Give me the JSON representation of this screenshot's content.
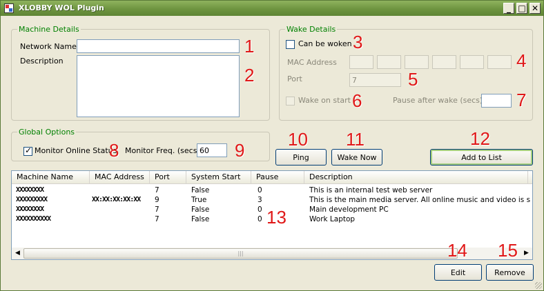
{
  "window": {
    "title": "XLOBBY WOL Plugin",
    "minimize": "_",
    "maximize": "□",
    "close": "✕"
  },
  "machine_details": {
    "legend": "Machine Details",
    "network_name_label": "Network Name:",
    "network_name_value": "",
    "description_label": "Description",
    "description_value": ""
  },
  "wake_details": {
    "legend": "Wake Details",
    "can_be_woken_label": "Can be woken",
    "can_be_woken_checked": false,
    "mac_label": "MAC Address",
    "mac_octets": [
      "",
      "",
      "",
      "",
      "",
      ""
    ],
    "port_label": "Port",
    "port_value": "7",
    "wake_on_start_label": "Wake on start",
    "wake_on_start_checked": false,
    "pause_label": "Pause after wake (secs)",
    "pause_value": ""
  },
  "global_options": {
    "legend": "Global Options",
    "monitor_online_label": "Monitor Online Status",
    "monitor_online_checked": true,
    "monitor_freq_label": "Monitor Freq. (secs)",
    "monitor_freq_value": "60"
  },
  "buttons": {
    "ping": "Ping",
    "wake_now": "Wake Now",
    "add_to_list": "Add to List",
    "edit": "Edit",
    "remove": "Remove"
  },
  "table": {
    "columns": [
      "Machine Name",
      "MAC Address",
      "Port",
      "System Start",
      "Pause",
      "Description"
    ],
    "rows": [
      {
        "name": "XXXXXXXX",
        "mac": "",
        "port": "7",
        "start": "False",
        "pause": "0",
        "desc": "This is an internal test web server"
      },
      {
        "name": "XXXXXXXXX",
        "mac": "XX:XX:XX:XX:XX",
        "port": "9",
        "start": "True",
        "pause": "3",
        "desc": "This is the main media server. All online music and video is store..."
      },
      {
        "name": "XXXXXXXX",
        "mac": "",
        "port": "7",
        "start": "False",
        "pause": "0",
        "desc": "Main development PC"
      },
      {
        "name": "XXXXXXXXXX",
        "mac": "",
        "port": "7",
        "start": "False",
        "pause": "0",
        "desc": "Work Laptop"
      }
    ],
    "scroll_left": "◀",
    "scroll_right": "▶",
    "scroll_grip": "|||"
  },
  "annotations": [
    "1",
    "2",
    "3",
    "4",
    "5",
    "6",
    "7",
    "8",
    "9",
    "10",
    "11",
    "12",
    "13",
    "14",
    "15"
  ],
  "colors": {
    "accent_green": "#008000",
    "annotation_red": "#e01818",
    "titlebar": "#6e9440"
  },
  "icons": [
    "app-icon",
    "minimize-icon",
    "maximize-icon",
    "close-icon",
    "check-icon",
    "scroll-left-icon",
    "scroll-right-icon",
    "resize-grip-icon"
  ]
}
